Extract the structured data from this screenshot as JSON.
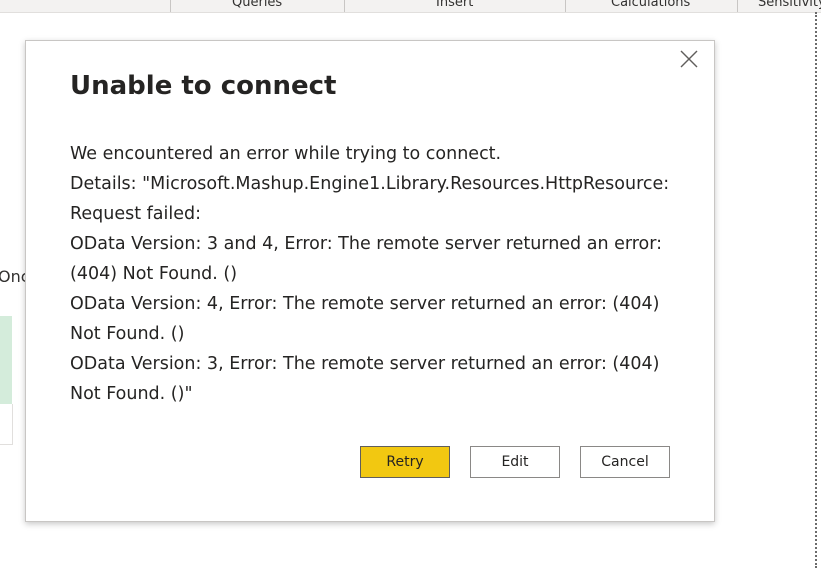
{
  "ribbon": {
    "groups": [
      "Queries",
      "Insert",
      "Calculations",
      "Sensitivity"
    ]
  },
  "background": {
    "partial_text": "Onc"
  },
  "dialog": {
    "title": "Unable to connect",
    "close_icon": "close-icon",
    "message_lines": [
      "We encountered an error while trying to connect.",
      "Details: \"Microsoft.Mashup.Engine1.Library.Resources.HttpResource:",
      "Request failed:",
      "OData Version: 3 and 4, Error: The remote server returned an error:",
      "(404) Not Found. ()",
      "OData Version: 4, Error: The remote server returned an error: (404)",
      "Not Found. ()",
      "OData Version: 3, Error: The remote server returned an error: (404)",
      "Not Found. ()\""
    ],
    "buttons": {
      "retry": "Retry",
      "edit": "Edit",
      "cancel": "Cancel"
    }
  },
  "colors": {
    "primary_button": "#f2c811",
    "background_card": "#d4ecdb"
  }
}
